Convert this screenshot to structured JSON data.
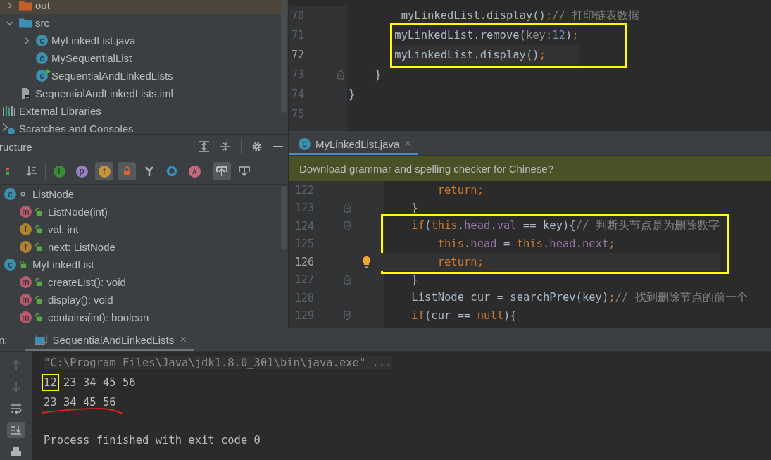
{
  "project_tree": [
    {
      "label": "out",
      "kind": "folder-out",
      "expanded": false,
      "selected": true
    },
    {
      "label": "src",
      "kind": "folder-src",
      "expanded": true,
      "selected": false,
      "children": [
        {
          "label": "MyLinkedList.java",
          "kind": "class",
          "badge": "c",
          "expanded": false,
          "selected": false
        },
        {
          "label": "MySequentialList",
          "kind": "class",
          "badge": "c",
          "selected": false
        },
        {
          "label": "SequentialAndLinkedLists",
          "kind": "main-class",
          "badge": "c",
          "selected": false
        }
      ]
    },
    {
      "label": "SequentialAndLinkedLists.iml",
      "kind": "file",
      "selected": false
    },
    {
      "label": "External Libraries",
      "kind": "library",
      "selected": false
    },
    {
      "label": "Scratches and Consoles",
      "kind": "scratch",
      "selected": false
    }
  ],
  "structure": {
    "title": "ructure",
    "toolbar": [
      {
        "kind": "sort-type",
        "on": false
      },
      {
        "kind": "sort-alpha",
        "on": false
      },
      {
        "kind": "badge",
        "badge": "I",
        "color": "#3f8a3a",
        "on": false
      },
      {
        "kind": "badge",
        "badge": "p",
        "color": "#9a7fc4",
        "on": false
      },
      {
        "kind": "badge",
        "badge": "f",
        "color": "#c4933c",
        "on": true
      },
      {
        "kind": "lock",
        "on": true
      },
      {
        "kind": "fork",
        "on": false
      },
      {
        "kind": "ring",
        "on": false
      },
      {
        "kind": "badge",
        "badge": "λ",
        "color": "#c4687c",
        "on": false
      },
      {
        "kind": "scroll-from",
        "on": true
      },
      {
        "kind": "scroll-to",
        "on": false
      }
    ],
    "items": [
      {
        "label": "ListNode",
        "kind": "class",
        "badge": "c",
        "public": false,
        "children": [
          {
            "label": "ListNode(int)",
            "kind": "method",
            "badge": "m",
            "public": true
          },
          {
            "label": "val: int",
            "kind": "field",
            "badge": "f",
            "public": true
          },
          {
            "label": "next: ListNode",
            "kind": "field",
            "badge": "f",
            "public": true
          }
        ]
      },
      {
        "label": "MyLinkedList",
        "kind": "class",
        "badge": "c",
        "public": true,
        "children": [
          {
            "label": "createList(): void",
            "kind": "method",
            "badge": "m",
            "public": true
          },
          {
            "label": "display(): void",
            "kind": "method",
            "badge": "m",
            "public": true
          },
          {
            "label": "contains(int): boolean",
            "kind": "method",
            "badge": "m",
            "public": true
          }
        ]
      }
    ]
  },
  "top_editor": {
    "blocks": [
      {
        "boxed": false,
        "lines": [
          {
            "number": "70",
            "tokens": [
              {
                "kind": "plain",
                "text": "        myLinkedList.display()"
              },
              {
                "kind": "kw",
                "text": ";"
              },
              {
                "kind": "comment",
                "text": "// 打印链表数据"
              }
            ]
          }
        ]
      },
      {
        "boxed": true,
        "lines": [
          {
            "number": "71",
            "tokens": [
              {
                "kind": "plain",
                "text": "        myLinkedList.remove("
              },
              {
                "kind": "hint",
                "text": "key:"
              },
              {
                "kind": "num",
                "text": "12"
              },
              {
                "kind": "plain",
                "text": ")"
              },
              {
                "kind": "kw",
                "text": ";"
              }
            ]
          },
          {
            "number": "72",
            "current": true,
            "tokens": [
              {
                "kind": "plain",
                "text": "        myLinkedList.display()"
              },
              {
                "kind": "kw",
                "text": ";"
              }
            ]
          }
        ]
      },
      {
        "boxed": false,
        "lines": [
          {
            "number": "73",
            "fold_end": true,
            "tokens": [
              {
                "kind": "plain",
                "text": "    }"
              }
            ]
          },
          {
            "number": "74",
            "tokens": [
              {
                "kind": "plain",
                "text": "}"
              }
            ]
          },
          {
            "number": "75"
          }
        ]
      }
    ]
  },
  "editor_tab": {
    "badge": "c",
    "label": "MyLinkedList.java",
    "close": "×",
    "selected": true
  },
  "banner": "Download grammar and spelling checker for Chinese?",
  "bottom_editor": {
    "blocks": [
      {
        "boxed": false,
        "lines": [
          {
            "number": "122",
            "tokens": [
              {
                "kind": "kw",
                "text": "        return;"
              }
            ]
          },
          {
            "number": "123",
            "fold_end": true,
            "tokens": [
              {
                "kind": "plain",
                "text": "    }"
              }
            ]
          }
        ]
      },
      {
        "boxed": true,
        "lines": [
          {
            "number": "124",
            "fold_start": true,
            "tokens": [
              {
                "kind": "kw",
                "text": "    if"
              },
              {
                "kind": "plain",
                "text": "("
              },
              {
                "kind": "kw",
                "text": "this"
              },
              {
                "kind": "plain",
                "text": "."
              },
              {
                "kind": "field",
                "text": "head"
              },
              {
                "kind": "plain",
                "text": "."
              },
              {
                "kind": "field",
                "text": "val"
              },
              {
                "kind": "plain",
                "text": " == key){"
              },
              {
                "kind": "comment",
                "text": "// 判断头节点是为删除数字"
              }
            ]
          },
          {
            "number": "125",
            "tokens": [
              {
                "kind": "kw",
                "text": "        this"
              },
              {
                "kind": "plain",
                "text": "."
              },
              {
                "kind": "field",
                "text": "head"
              },
              {
                "kind": "plain",
                "text": " = "
              },
              {
                "kind": "kw",
                "text": "this"
              },
              {
                "kind": "plain",
                "text": "."
              },
              {
                "kind": "field",
                "text": "head"
              },
              {
                "kind": "plain",
                "text": "."
              },
              {
                "kind": "field",
                "text": "next"
              },
              {
                "kind": "kw",
                "text": ";"
              }
            ]
          },
          {
            "number": "126",
            "current": true,
            "bulb": true,
            "tokens": [
              {
                "kind": "kw",
                "text": "        return;"
              }
            ]
          }
        ]
      },
      {
        "boxed": false,
        "lines": [
          {
            "number": "127",
            "fold_end": true,
            "tokens": [
              {
                "kind": "plain",
                "text": "    }"
              }
            ]
          },
          {
            "number": "128",
            "tokens": [
              {
                "kind": "plain",
                "text": "    ListNode cur = searchPrev(key)"
              },
              {
                "kind": "kw",
                "text": ";"
              },
              {
                "kind": "comment",
                "text": "// 找到删除节点的前一个"
              }
            ]
          },
          {
            "number": "129",
            "fold_start": true,
            "tokens": [
              {
                "kind": "kw",
                "text": "    if"
              },
              {
                "kind": "plain",
                "text": "(cur == "
              },
              {
                "kind": "kw",
                "text": "null"
              },
              {
                "kind": "plain",
                "text": "){"
              }
            ]
          }
        ]
      }
    ]
  },
  "run": {
    "label": "n:",
    "tab": {
      "label": "SequentialAndLinkedLists",
      "close": "×",
      "selected": true
    },
    "toolbar": [
      {
        "kind": "up",
        "on": false,
        "disabled": true
      },
      {
        "kind": "down",
        "on": false,
        "disabled": true
      },
      {
        "kind": "wrap",
        "on": false,
        "disabled": false
      },
      {
        "kind": "scroll-end",
        "on": true,
        "disabled": false
      },
      {
        "kind": "print",
        "on": false,
        "disabled": false
      }
    ],
    "console": [
      {
        "kind": "command",
        "text": "\"C:\\Program Files\\Java\\jdk1.8.0_301\\bin\\java.exe\" ..."
      },
      {
        "kind": "output",
        "marked": "12",
        "text": " 23 34 45 56"
      },
      {
        "kind": "output",
        "underlined": true,
        "text": "23 34 45 56"
      },
      {
        "kind": "exit",
        "text": "Process finished with exit code 0"
      }
    ]
  }
}
